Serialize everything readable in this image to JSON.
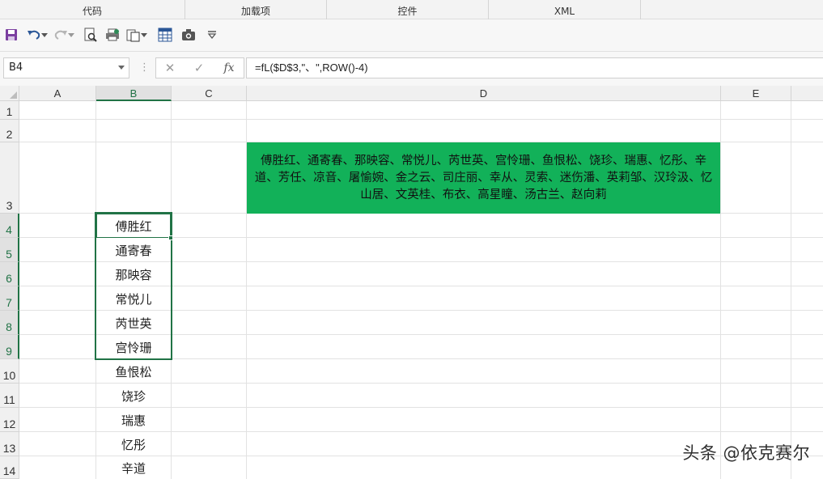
{
  "ribbon": {
    "groups": [
      "代码",
      "加载项",
      "控件",
      "XML"
    ]
  },
  "toolbar": {
    "icons": [
      "save-icon",
      "undo-icon",
      "redo-icon",
      "print-preview-icon",
      "print-icon",
      "paste-special-icon",
      "table-icon",
      "camera-icon",
      "customize-icon"
    ]
  },
  "formula_bar": {
    "name_box": "B4",
    "cancel_glyph": "✕",
    "enter_glyph": "✓",
    "fx_label": "fx",
    "formula": "=fL($D$3,\"、\",ROW()-4)"
  },
  "sheet": {
    "columns": [
      "A",
      "B",
      "C",
      "D",
      "E"
    ],
    "rows": [
      "1",
      "2",
      "3",
      "4",
      "5",
      "6",
      "7",
      "8",
      "9",
      "10",
      "11",
      "12",
      "13",
      "14"
    ],
    "d3_text": "傅胜红、通寄春、那映容、常悦儿、芮世英、宫怜珊、鱼恨松、饶珍、瑞惠、忆彤、辛道、芳任、凉音、屠愉婉、金之云、司庄丽、幸从、灵索、迷伤潘、英莉邹、汉玲汲、忆山居、文英桂、布衣、高星瞳、汤古兰、赵向莉",
    "b_values": [
      "傅胜红",
      "通寄春",
      "那映容",
      "常悦儿",
      "芮世英",
      "宫怜珊",
      "鱼恨松",
      "饶珍",
      "瑞惠",
      "忆彤",
      "辛道"
    ],
    "fill_color": "#12b159",
    "accent_color": "#217346"
  },
  "watermark": "头条 @依克赛尔"
}
